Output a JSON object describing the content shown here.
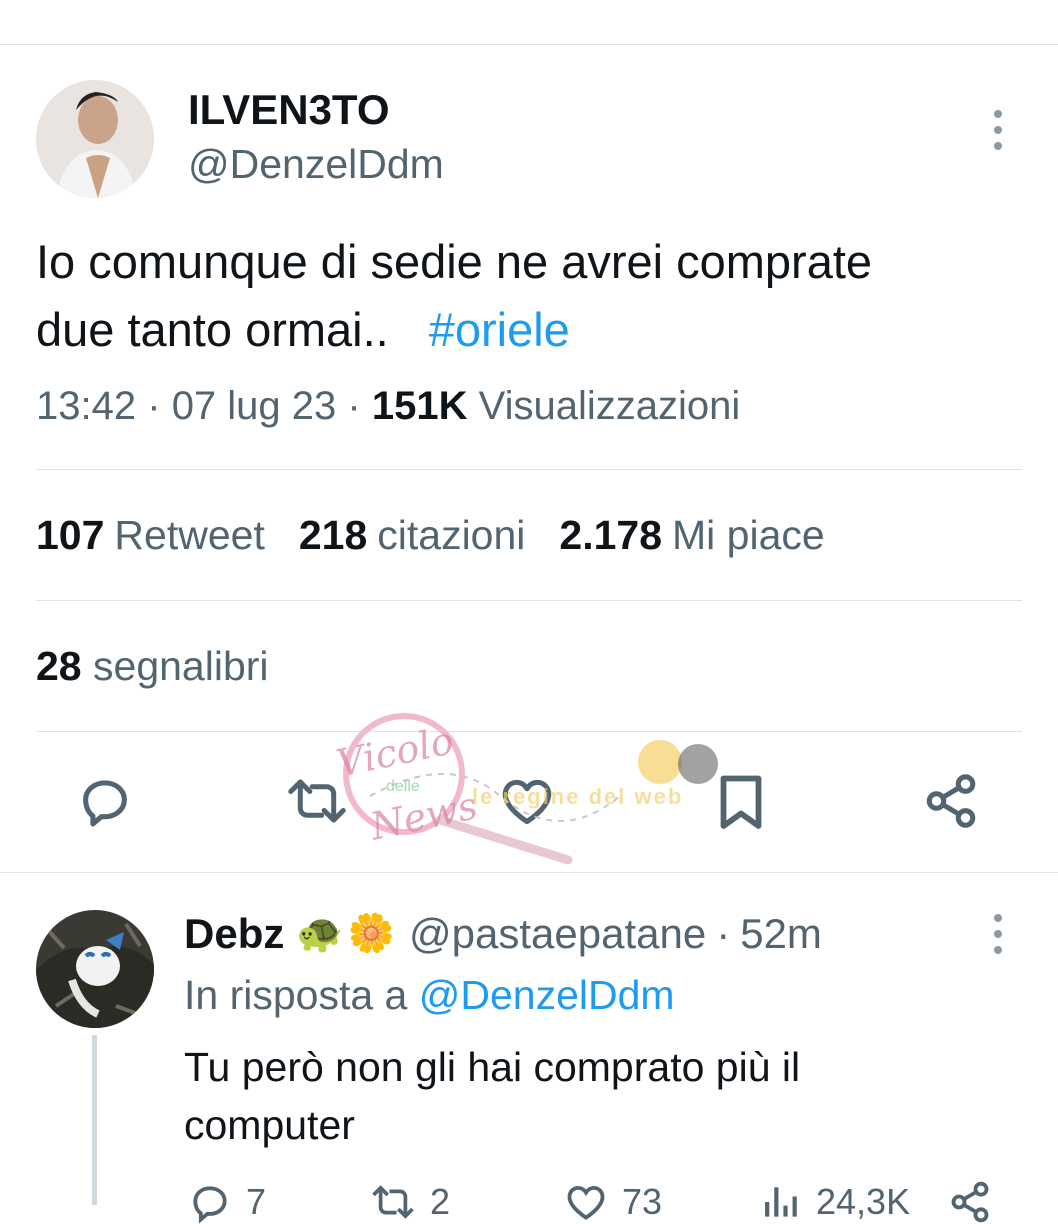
{
  "tweet": {
    "author_name": "ILVEN3TO",
    "author_handle": "@DenzelDdm",
    "text_line1": "Io comunque di sedie ne avrei comprate",
    "text_line2": "due tanto ormai..",
    "hashtag": "#oriele",
    "time": "13:42",
    "date": "07 lug 23",
    "views_count": "151K",
    "views_label": "Visualizzazioni",
    "separator": "·"
  },
  "stats": {
    "retweets_count": "107",
    "retweets_label": "Retweet",
    "quotes_count": "218",
    "quotes_label": "citazioni",
    "likes_count": "2.178",
    "likes_label": "Mi piace",
    "bookmarks_count": "28",
    "bookmarks_label": "segnalibri"
  },
  "actions": {
    "icons": [
      "reply-icon",
      "retweet-icon",
      "like-icon",
      "bookmark-icon",
      "share-icon"
    ]
  },
  "reply": {
    "author_name": "Debz",
    "emojis": [
      "🐢",
      "🌼"
    ],
    "author_handle": "@pastaepatane",
    "separator": "·",
    "time": "52m",
    "replying_prefix": "In risposta a",
    "replying_to": "@DenzelDdm",
    "text_line1": "Tu però non gli hai comprato più il",
    "text_line2": "computer",
    "reply_count": "7",
    "retweet_count": "2",
    "like_count": "73",
    "views_count": "24,3K"
  },
  "watermark": {
    "text1": "Vicolo",
    "text2": "delle",
    "text3": "News",
    "text4": "le regine del web"
  },
  "colors": {
    "accent": "#1d9bf0",
    "muted": "#536471",
    "text": "#0f1419",
    "divider": "#dfe3e6"
  }
}
